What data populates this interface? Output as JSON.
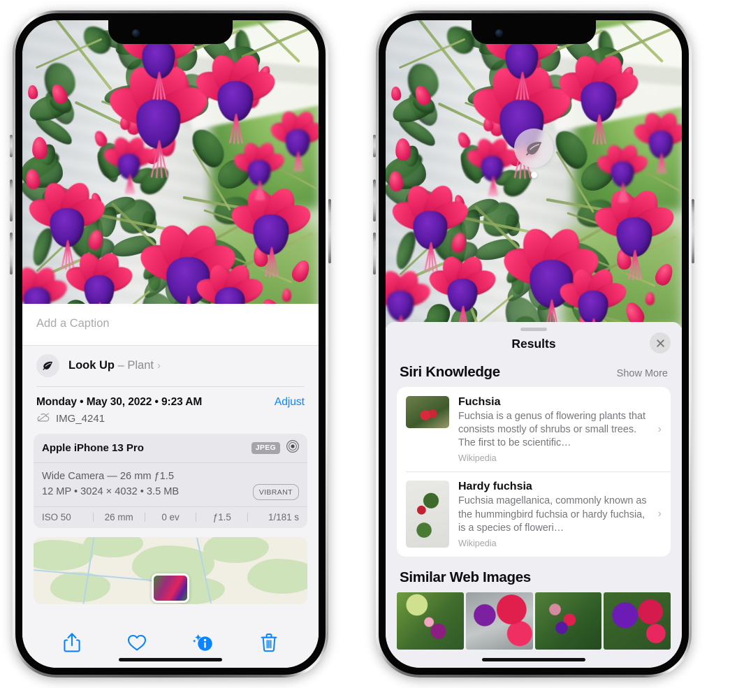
{
  "left_phone": {
    "caption": {
      "placeholder": "Add a Caption",
      "value": ""
    },
    "lookup": {
      "label": "Look Up",
      "dash": "–",
      "subject": "Plant",
      "chevron": "›",
      "icon": "leaf-icon"
    },
    "details": {
      "datetime": "Monday • May 30, 2022 • 9:23 AM",
      "adjust_label": "Adjust",
      "filename": "IMG_4241",
      "cloud_icon": "icloud-slash-icon"
    },
    "metadata": {
      "device": "Apple iPhone 13 Pro",
      "format_badge": "JPEG",
      "lens_icon": "aperture-icon",
      "lens_line": "Wide Camera — 26 mm ƒ1.5",
      "size_line": "12 MP • 3024 × 4032 • 3.5 MB",
      "profile_badge": "VIBRANT",
      "exposure": [
        "ISO 50",
        "26 mm",
        "0 ev",
        "ƒ1.5",
        "1/181 s"
      ]
    },
    "toolbar": [
      {
        "name": "share-button",
        "icon": "share-icon"
      },
      {
        "name": "favorite-button",
        "icon": "heart-icon"
      },
      {
        "name": "info-button",
        "icon": "info-sparkle-icon"
      },
      {
        "name": "delete-button",
        "icon": "trash-icon"
      }
    ],
    "accent_color": "#0a84ff"
  },
  "right_phone": {
    "lookup_pin": {
      "icon": "leaf-icon"
    },
    "sheet": {
      "title": "Results",
      "close_icon": "close-icon",
      "siri_knowledge": {
        "title": "Siri Knowledge",
        "show_more": "Show More",
        "items": [
          {
            "title": "Fuchsia",
            "description": "Fuchsia is a genus of flowering plants that consists mostly of shrubs or small trees. The first to be scientific…",
            "source": "Wikipedia",
            "chevron": "›"
          },
          {
            "title": "Hardy fuchsia",
            "description": "Fuchsia magellanica, commonly known as the hummingbird fuchsia or hardy fuchsia, is a species of floweri…",
            "source": "Wikipedia",
            "chevron": "›"
          }
        ]
      },
      "similar_web_images": {
        "title": "Similar Web Images",
        "thumbnails": [
          "web-image-1",
          "web-image-2",
          "web-image-3",
          "web-image-4"
        ]
      }
    }
  }
}
